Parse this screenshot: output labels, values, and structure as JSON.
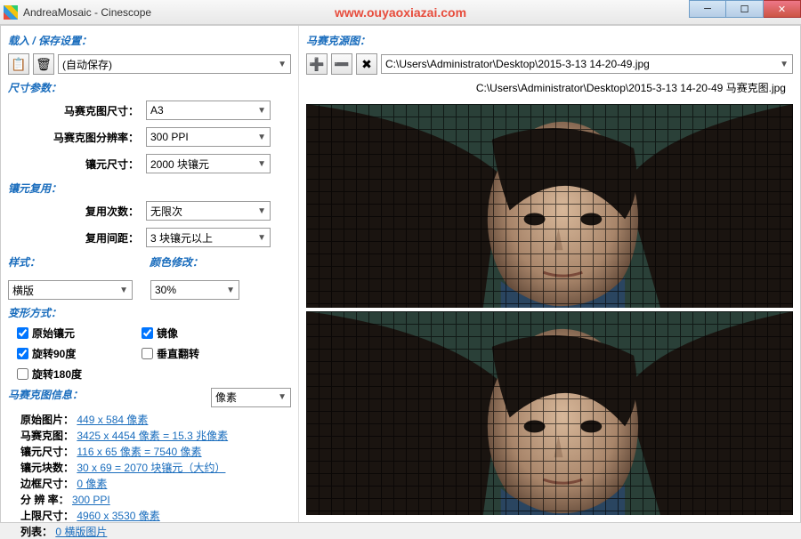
{
  "window": {
    "title": "AndreaMosaic - Cinescope"
  },
  "watermark": "www.ouyaoxiazai.com",
  "load_save": {
    "header": "载入 / 保存设置：",
    "auto_save": "(自动保存)"
  },
  "source": {
    "header": "马赛克源图：",
    "path": "C:\\Users\\Administrator\\Desktop\\2015-3-13 14-20-49.jpg",
    "output_path": "C:\\Users\\Administrator\\Desktop\\2015-3-13 14-20-49 马赛克图.jpg"
  },
  "size_params": {
    "header": "尺寸参数：",
    "mosaic_size": {
      "label": "马赛克图尺寸：",
      "value": "A3"
    },
    "mosaic_res": {
      "label": "马赛克图分辨率：",
      "value": "300 PPI"
    },
    "tile_size": {
      "label": "镶元尺寸：",
      "value": "2000 块镶元"
    }
  },
  "tile_reuse": {
    "header": "镶元复用：",
    "count": {
      "label": "复用次数：",
      "value": "无限次"
    },
    "spacing": {
      "label": "复用间距：",
      "value": "3 块镶元以上"
    }
  },
  "style": {
    "header": "样式：",
    "value": "横版",
    "color_header": "颜色修改：",
    "color_value": "30%"
  },
  "transform": {
    "header": "变形方式：",
    "original": "原始镶元",
    "mirror": "镜像",
    "rotate90": "旋转90度",
    "flip_v": "垂直翻转",
    "rotate180": "旋转180度"
  },
  "mosaic_info": {
    "header": "马赛克图信息：",
    "unit": "像素",
    "lines": {
      "orig_label": "原始图片：",
      "orig_val": "449 x 584 像素",
      "mosaic_label": "马赛克图：",
      "mosaic_val": "3425 x 4454 像素 = 15.3 兆像素",
      "tile_label": "镶元尺寸：",
      "tile_val": "116 x 65 像素 = 7540 像素",
      "count_label": "镶元块数：",
      "count_val": "30 x 69 = 2070 块镶元（大约）",
      "border_label": "边框尺寸：",
      "border_val": "0 像素",
      "res_label": "分 辨 率：",
      "res_val": "300 PPI",
      "limit_label": "上限尺寸：",
      "limit_val": "4960 x 3530 像素",
      "list_label": "列表：",
      "list_val": "0 横版图片"
    }
  }
}
